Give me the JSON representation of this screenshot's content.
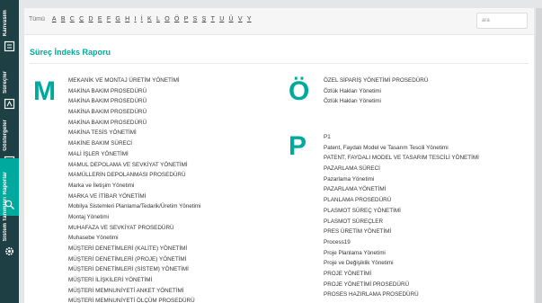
{
  "nav": [
    {
      "label": "Kanvasim",
      "icon": "book-icon",
      "active": false
    },
    {
      "label": "Süreçler",
      "icon": "process-icon",
      "active": false
    },
    {
      "label": "Göstergeler",
      "icon": "chart-icon",
      "active": false
    },
    {
      "label": "Raporlar",
      "icon": "report-icon",
      "active": true
    },
    {
      "label": "Sistem Tanımları",
      "icon": "gear-icon",
      "active": false
    }
  ],
  "filter": {
    "all_label": "Tümü",
    "letters": [
      "A",
      "B",
      "C",
      "Ç",
      "D",
      "E",
      "F",
      "G",
      "H",
      "I",
      "İ",
      "K",
      "L",
      "O",
      "Ö",
      "P",
      "S",
      "Ş",
      "T",
      "U",
      "Ü",
      "V",
      "Y"
    ]
  },
  "search": {
    "placeholder": "ara"
  },
  "title": "Süreç İndeks Raporu",
  "groups": [
    {
      "letter": "M",
      "items": [
        "MEKANİK VE MONTAJ ÜRETİM YÖNETİMİ",
        "MAKİNA BAKIM PROSEDÜRÜ",
        "MAKİNA BAKIM PROSEDÜRÜ",
        "MAKİNA BAKIM PROSEDÜRÜ",
        "MAKİNA BAKIM PROSEDÜRÜ",
        "MAKİNA TESİS YÖNETİMİ",
        "MAKİNE BAKIM SÜRECİ",
        "MALİ İŞLER YÖNETİMİ",
        "MAMUL DEPOLAMA VE SEVKİYAT YÖNETİMİ",
        "MAMÜLLERİN DEPOLANMASI PROSEDÜRÜ",
        "Marka ve İletişim Yönetimi",
        "MARKA VE İTİBAR YÖNETİMİ",
        "Mobilya Sistemleri Planlama/Tedarik/Üretim Yönetimi",
        "Montaj Yönetimi",
        "MUHAFAZA VE SEVKİYAT PROSEDÜRÜ",
        "Muhasebe Yönetimi",
        "MÜŞTERİ DENETİMLERİ (KALİTE) YÖNETİMİ",
        "MÜŞTERİ DENETİMLERİ (PROJE) YÖNETİMİ",
        "MÜŞTERİ DENETİMLERİ (SİSTEM) YÖNETİMİ",
        "MÜŞTERİ İLİŞKİLERİ YÖNETİMİ",
        "MÜŞTERİ MEMNUNİYETİ ANKET YÖNETİMİ",
        "MÜŞTERİ MEMNUNİYETİ ÖLÇÜM PROSEDÜRÜ"
      ]
    },
    {
      "letter": "Ö",
      "items": [
        "ÖZEL SİPARİŞ YÖNETİMİ PROSEDÜRÜ",
        "Özlük Hakları Yönetimi",
        "Özlük Hakları Yönetimi"
      ]
    },
    {
      "letter": "P",
      "items": [
        "P1",
        "Patent, Faydalı Model ve Tasarım Tescili Yönetimi",
        "PATENT, FAYDALI MODEL VE TASARIM TESCİLİ YÖNETİMİ",
        "PAZARLAMA SÜRECİ",
        "Pazarlama Yönetimi",
        "PAZARLAMA YÖNETİMİ",
        "PLANLAMA PROSEDÜRÜ",
        "PLASMOT SÜREÇ YÖNETİMİ",
        "PLASMOT SÜREÇLER",
        "PRES ÜRETİM YÖNETİMİ",
        "Process19",
        "Proje Planlama Yönetimi",
        "Proje ve Değişiklik Yönetimi",
        "PROJE YÖNETİMİ",
        "PROJE YÖNETİMİ PROSEDÜRÜ",
        "PROSES HAZIRLAMA PROSEDÜRÜ"
      ]
    }
  ],
  "colors": {
    "accent": "#00a99d",
    "sidebar": "#1e3f44"
  }
}
